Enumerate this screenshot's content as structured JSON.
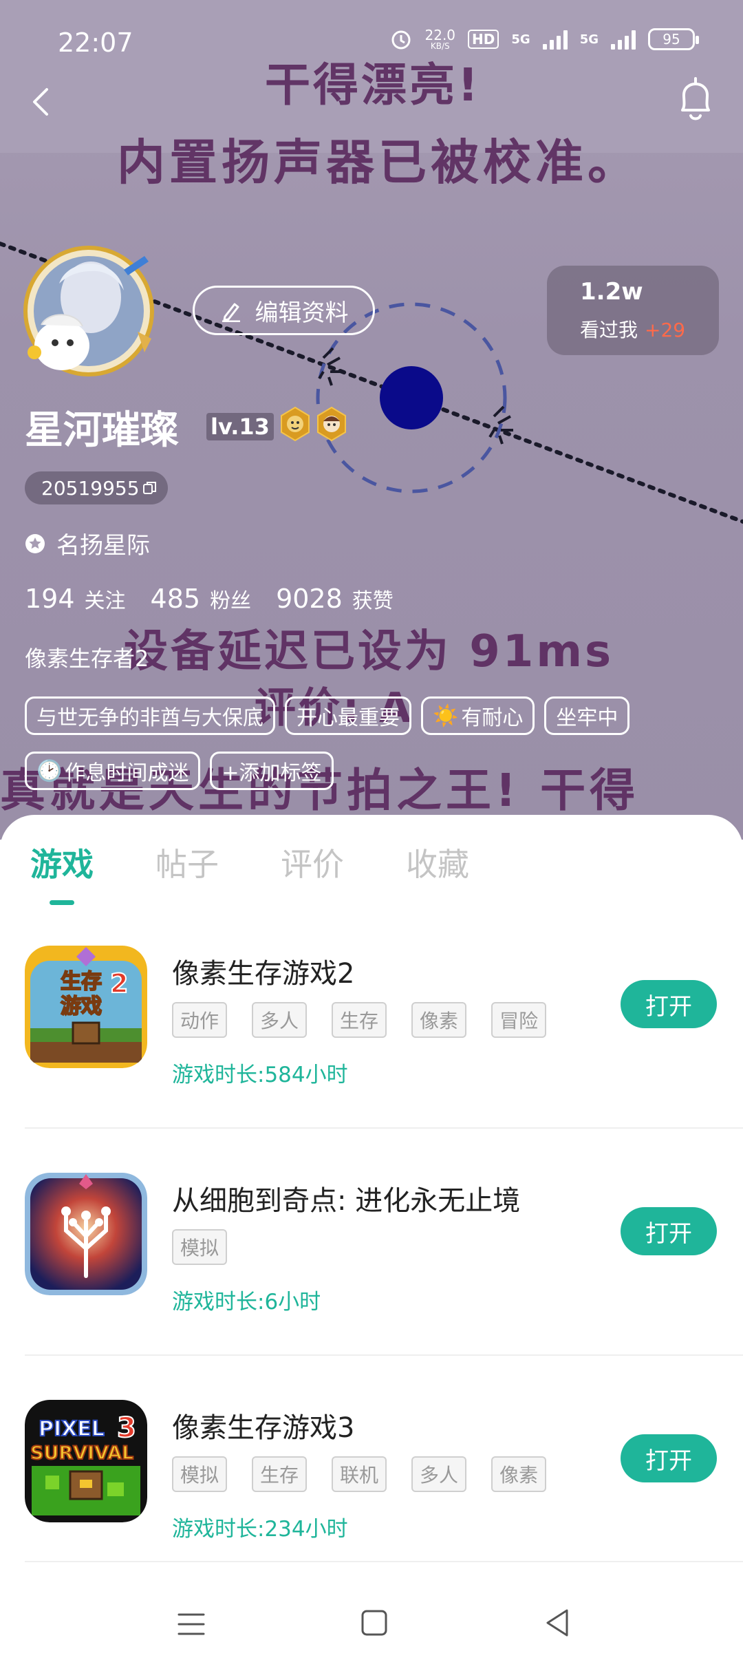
{
  "status_bar": {
    "time": "22:07",
    "net_speed": "22.0",
    "net_unit": "KB/S",
    "hd_label": "HD",
    "net1": "5G",
    "net2": "5G",
    "battery": "95"
  },
  "overlay_text": {
    "line1": "干得漂亮!",
    "line2": "内置扬声器已被校准。",
    "line3": "设备延迟已设为 91ms",
    "line4": "评价: A",
    "line5": "真就是天生的节拍之王! 干得"
  },
  "header": {
    "back_icon": "chevron-left-icon",
    "bell_icon": "bell-icon"
  },
  "profile": {
    "edit_label": "编辑资料",
    "visitors_count": "1.2w",
    "visitors_label": "看过我",
    "visitors_delta": "+29",
    "username": "星河璀璨",
    "level": "lv.13",
    "user_id": "20519955",
    "title": "名扬星际",
    "stats": [
      {
        "value": "194",
        "label": "关注"
      },
      {
        "value": "485",
        "label": "粉丝"
      },
      {
        "value": "9028",
        "label": "获赞"
      }
    ],
    "bio": "像素生存者2",
    "tags": [
      {
        "icon": "",
        "text": "与世无争的非酋与大保底"
      },
      {
        "icon": "",
        "text": "开心最重要"
      },
      {
        "icon": "☀️",
        "text": "有耐心"
      },
      {
        "icon": "",
        "text": "坐牢中"
      },
      {
        "icon": "🕑",
        "text": "作息时间成迷"
      },
      {
        "icon": "",
        "text": "+添加标签"
      }
    ]
  },
  "tabs": [
    "游戏",
    "帖子",
    "评价",
    "收藏"
  ],
  "games": [
    {
      "name": "像素生存游戏2",
      "genres": [
        "动作",
        "多人",
        "生存",
        "像素",
        "冒险"
      ],
      "playtime_label": "游戏时长:",
      "playtime_value": "584小时",
      "button": "打开",
      "icon_text_1": "生存",
      "icon_text_2": "游戏",
      "icon_num": "2"
    },
    {
      "name": "从细胞到奇点: 进化永无止境",
      "genres": [
        "模拟"
      ],
      "playtime_label": "游戏时长:",
      "playtime_value": "6小时",
      "button": "打开"
    },
    {
      "name": "像素生存游戏3",
      "genres": [
        "模拟",
        "生存",
        "联机",
        "多人",
        "像素"
      ],
      "playtime_label": "游戏时长:",
      "playtime_value": "234小时",
      "button": "打开",
      "icon_text_1": "PIXEL",
      "icon_text_2": "SURVIVAL",
      "icon_num": "3"
    }
  ],
  "colors": {
    "accent": "#1fb59a",
    "overlay_text": "#5a2a5e",
    "visitors_delta": "#ff6a4a"
  }
}
